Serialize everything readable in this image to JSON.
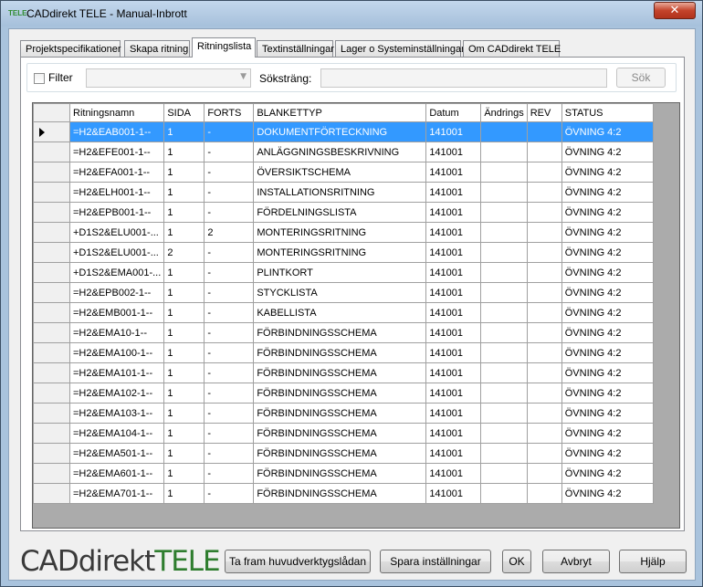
{
  "window": {
    "title": "CADdirekt TELE - Manual-Inbrott",
    "title_logo": "TELE"
  },
  "tabs": [
    {
      "label": "Projektspecifikationer",
      "active": false
    },
    {
      "label": "Skapa ritning",
      "active": false
    },
    {
      "label": "Ritningslista",
      "active": true
    },
    {
      "label": "Textinställningar",
      "active": false
    },
    {
      "label": "Lager o Systeminställningar",
      "active": false
    },
    {
      "label": "Om CADdirekt TELE",
      "active": false
    }
  ],
  "filter": {
    "label": "Filter",
    "checked": false,
    "combo_value": "",
    "search_label": "Söksträng:",
    "search_value": "",
    "search_button": "Sök"
  },
  "grid": {
    "columns": [
      "Ritningsnamn",
      "SIDA",
      "FORTS",
      "BLANKETTYP",
      "Datum",
      "Ändrings",
      "REV",
      "STATUS"
    ],
    "selected_row": 0,
    "rows": [
      [
        "=H2&EAB001-1--",
        "1",
        "-",
        "DOKUMENTFÖRTECKNING",
        "141001",
        "",
        "",
        "ÖVNING 4:2"
      ],
      [
        "=H2&EFE001-1--",
        "1",
        "-",
        "ANLÄGGNINGSBESKRIVNING",
        "141001",
        "",
        "",
        "ÖVNING 4:2"
      ],
      [
        "=H2&EFA001-1--",
        "1",
        "-",
        "ÖVERSIKTSCHEMA",
        "141001",
        "",
        "",
        "ÖVNING 4:2"
      ],
      [
        "=H2&ELH001-1--",
        "1",
        "-",
        "INSTALLATIONSRITNING",
        "141001",
        "",
        "",
        "ÖVNING 4:2"
      ],
      [
        "=H2&EPB001-1--",
        "1",
        "-",
        "FÖRDELNINGSLISTA",
        "141001",
        "",
        "",
        "ÖVNING 4:2"
      ],
      [
        "+D1S2&ELU001-...",
        "1",
        "2",
        "MONTERINGSRITNING",
        "141001",
        "",
        "",
        "ÖVNING 4:2"
      ],
      [
        "+D1S2&ELU001-...",
        "2",
        "-",
        "MONTERINGSRITNING",
        "141001",
        "",
        "",
        "ÖVNING 4:2"
      ],
      [
        "+D1S2&EMA001-...",
        "1",
        "-",
        "PLINTKORT",
        "141001",
        "",
        "",
        "ÖVNING 4:2"
      ],
      [
        "=H2&EPB002-1--",
        "1",
        "-",
        "STYCKLISTA",
        "141001",
        "",
        "",
        "ÖVNING 4:2"
      ],
      [
        "=H2&EMB001-1--",
        "1",
        "-",
        "KABELLISTA",
        "141001",
        "",
        "",
        "ÖVNING 4:2"
      ],
      [
        "=H2&EMA10-1--",
        "1",
        "-",
        "FÖRBINDNINGSSCHEMA",
        "141001",
        "",
        "",
        "ÖVNING 4:2"
      ],
      [
        "=H2&EMA100-1--",
        "1",
        "-",
        "FÖRBINDNINGSSCHEMA",
        "141001",
        "",
        "",
        "ÖVNING 4:2"
      ],
      [
        "=H2&EMA101-1--",
        "1",
        "-",
        "FÖRBINDNINGSSCHEMA",
        "141001",
        "",
        "",
        "ÖVNING 4:2"
      ],
      [
        "=H2&EMA102-1--",
        "1",
        "-",
        "FÖRBINDNINGSSCHEMA",
        "141001",
        "",
        "",
        "ÖVNING 4:2"
      ],
      [
        "=H2&EMA103-1--",
        "1",
        "-",
        "FÖRBINDNINGSSCHEMA",
        "141001",
        "",
        "",
        "ÖVNING 4:2"
      ],
      [
        "=H2&EMA104-1--",
        "1",
        "-",
        "FÖRBINDNINGSSCHEMA",
        "141001",
        "",
        "",
        "ÖVNING 4:2"
      ],
      [
        "=H2&EMA501-1--",
        "1",
        "-",
        "FÖRBINDNINGSSCHEMA",
        "141001",
        "",
        "",
        "ÖVNING 4:2"
      ],
      [
        "=H2&EMA601-1--",
        "1",
        "-",
        "FÖRBINDNINGSSCHEMA",
        "141001",
        "",
        "",
        "ÖVNING 4:2"
      ],
      [
        "=H2&EMA701-1--",
        "1",
        "-",
        "FÖRBINDNINGSSCHEMA",
        "141001",
        "",
        "",
        "ÖVNING 4:2"
      ]
    ]
  },
  "footer": {
    "logo_part1": "CADdirekt",
    "logo_part2": "TELE",
    "buttons": {
      "toolbox": "Ta fram huvudverktygslådan",
      "save_settings": "Spara inställningar",
      "ok": "OK",
      "cancel": "Avbryt",
      "help": "Hjälp"
    }
  },
  "colors": {
    "selection": "#3399ff",
    "window_frame": "#a9c3dd",
    "logo_green": "#2e7d2e"
  },
  "icons": {
    "close": "close-icon",
    "row_cursor": "row-pointer-icon",
    "combo": "chevron-down-icon"
  }
}
